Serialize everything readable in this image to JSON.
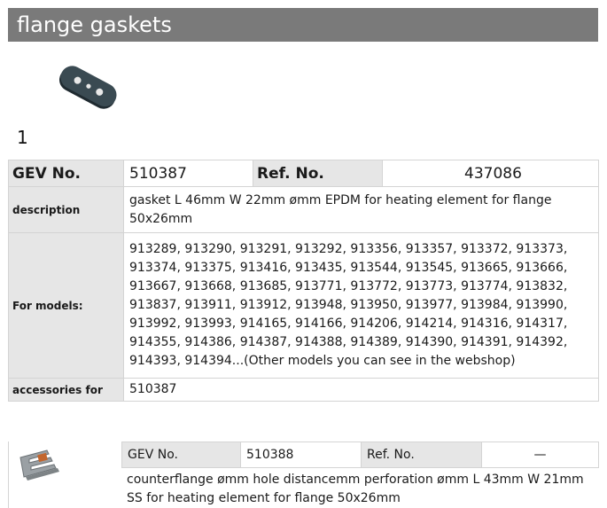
{
  "header": {
    "title": "flange gaskets"
  },
  "image": {
    "number": "1",
    "icon": "gasket-image"
  },
  "spec": {
    "gev_label": "GEV No.",
    "gev_value": "510387",
    "ref_label": "Ref. No.",
    "ref_value": "437086",
    "description_label": "description",
    "description_value": "gasket  L 46mm W 22mm ømm EPDM for heating element for flange 50x26mm",
    "models_label": "For models:",
    "models_value": "913289, 913290, 913291, 913292, 913356, 913357, 913372, 913373, 913374, 913375, 913416, 913435, 913544, 913545, 913665, 913666, 913667, 913668, 913685, 913771, 913772, 913773, 913774, 913832, 913837, 913911, 913912, 913948, 913950, 913977, 913984, 913990, 913992, 913993, 914165, 914166, 914206, 914214, 914316, 914317, 914355, 914386, 914387, 914388, 914389, 914390, 914391, 914392, 914393, 914394...(Other models you can see in the webshop)",
    "accessories_label": "accessories for",
    "accessories_value": "510387"
  },
  "accessory": {
    "icon": "counterflange-image",
    "gev_label": "GEV No.",
    "gev_value": "510388",
    "ref_label": "Ref. No.",
    "ref_value": "—",
    "description": "counterflange  ømm hole distancemm perforation ømm L 43mm W 21mm SS for heating element for flange 50x26mm"
  }
}
